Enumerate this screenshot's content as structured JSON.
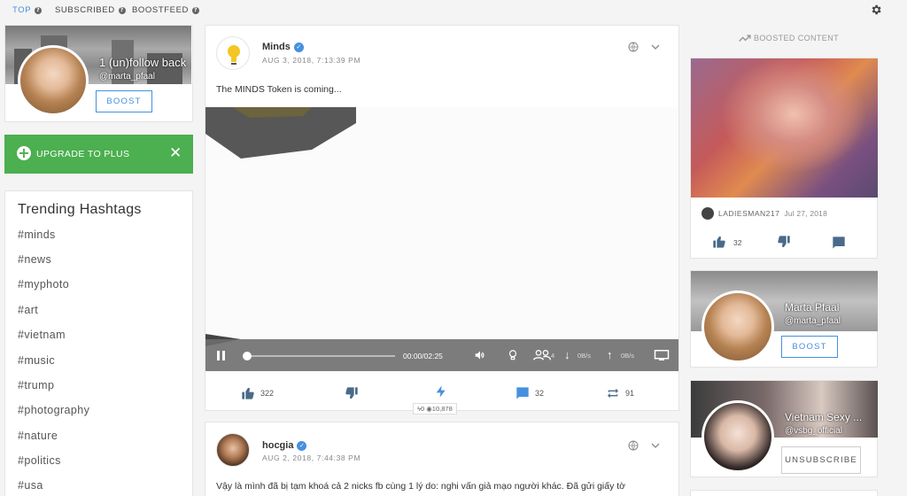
{
  "nav": {
    "tabs": [
      {
        "label": "TOP",
        "active": true
      },
      {
        "label": "SUBSCRIBED",
        "active": false
      },
      {
        "label": "BOOSTFEED",
        "active": false
      }
    ],
    "help_icon": "?",
    "settings_icon": "gear-icon"
  },
  "user_card": {
    "name": "1 (un)follow back",
    "handle": "@marta_pfaal",
    "boost_label": "BOOST"
  },
  "upgrade": {
    "label": "UPGRADE TO PLUS",
    "close_glyph": "✕",
    "color": "#4caf50"
  },
  "trending": {
    "title": "Trending Hashtags",
    "tags": [
      "#minds",
      "#news",
      "#myphoto",
      "#art",
      "#vietnam",
      "#music",
      "#trump",
      "#photography",
      "#nature",
      "#politics",
      "#usa"
    ]
  },
  "post1": {
    "author": "Minds",
    "date": "AUG 3, 2018, 7:13:39 PM",
    "text": "The MINDS Token is coming...",
    "video": {
      "time": "00:00/02:25",
      "viewers": "4",
      "down_rate": "0B/s",
      "up_rate": "0B/s"
    },
    "actions": {
      "up_votes": "322",
      "comments": "32",
      "reminds": "91"
    },
    "badge": {
      "boosts": "0",
      "views": "10,878"
    }
  },
  "post2": {
    "author": "hocgia",
    "date": "AUG 2, 2018, 7:44:38 PM",
    "text": "Vậy là mình đã bị tạm khoá cả 2 nicks fb cùng 1 lý do: nghi vấn giả mạo người khác. Đã gửi giấy tờ"
  },
  "boosted": {
    "heading": "BOOSTED CONTENT",
    "owner": "LADIESMAN217",
    "date": "Jul 27, 2018",
    "up_votes": "32"
  },
  "suggest1": {
    "name": "Marta Pfaal",
    "handle": "@marta_pfaal",
    "button": "BOOST"
  },
  "suggest2": {
    "name": "Vietnam Sexy ...",
    "handle": "@vsbg_official",
    "button": "UNSUBSCRIBE"
  },
  "colors": {
    "accent": "#4690df",
    "green": "#4caf50"
  }
}
